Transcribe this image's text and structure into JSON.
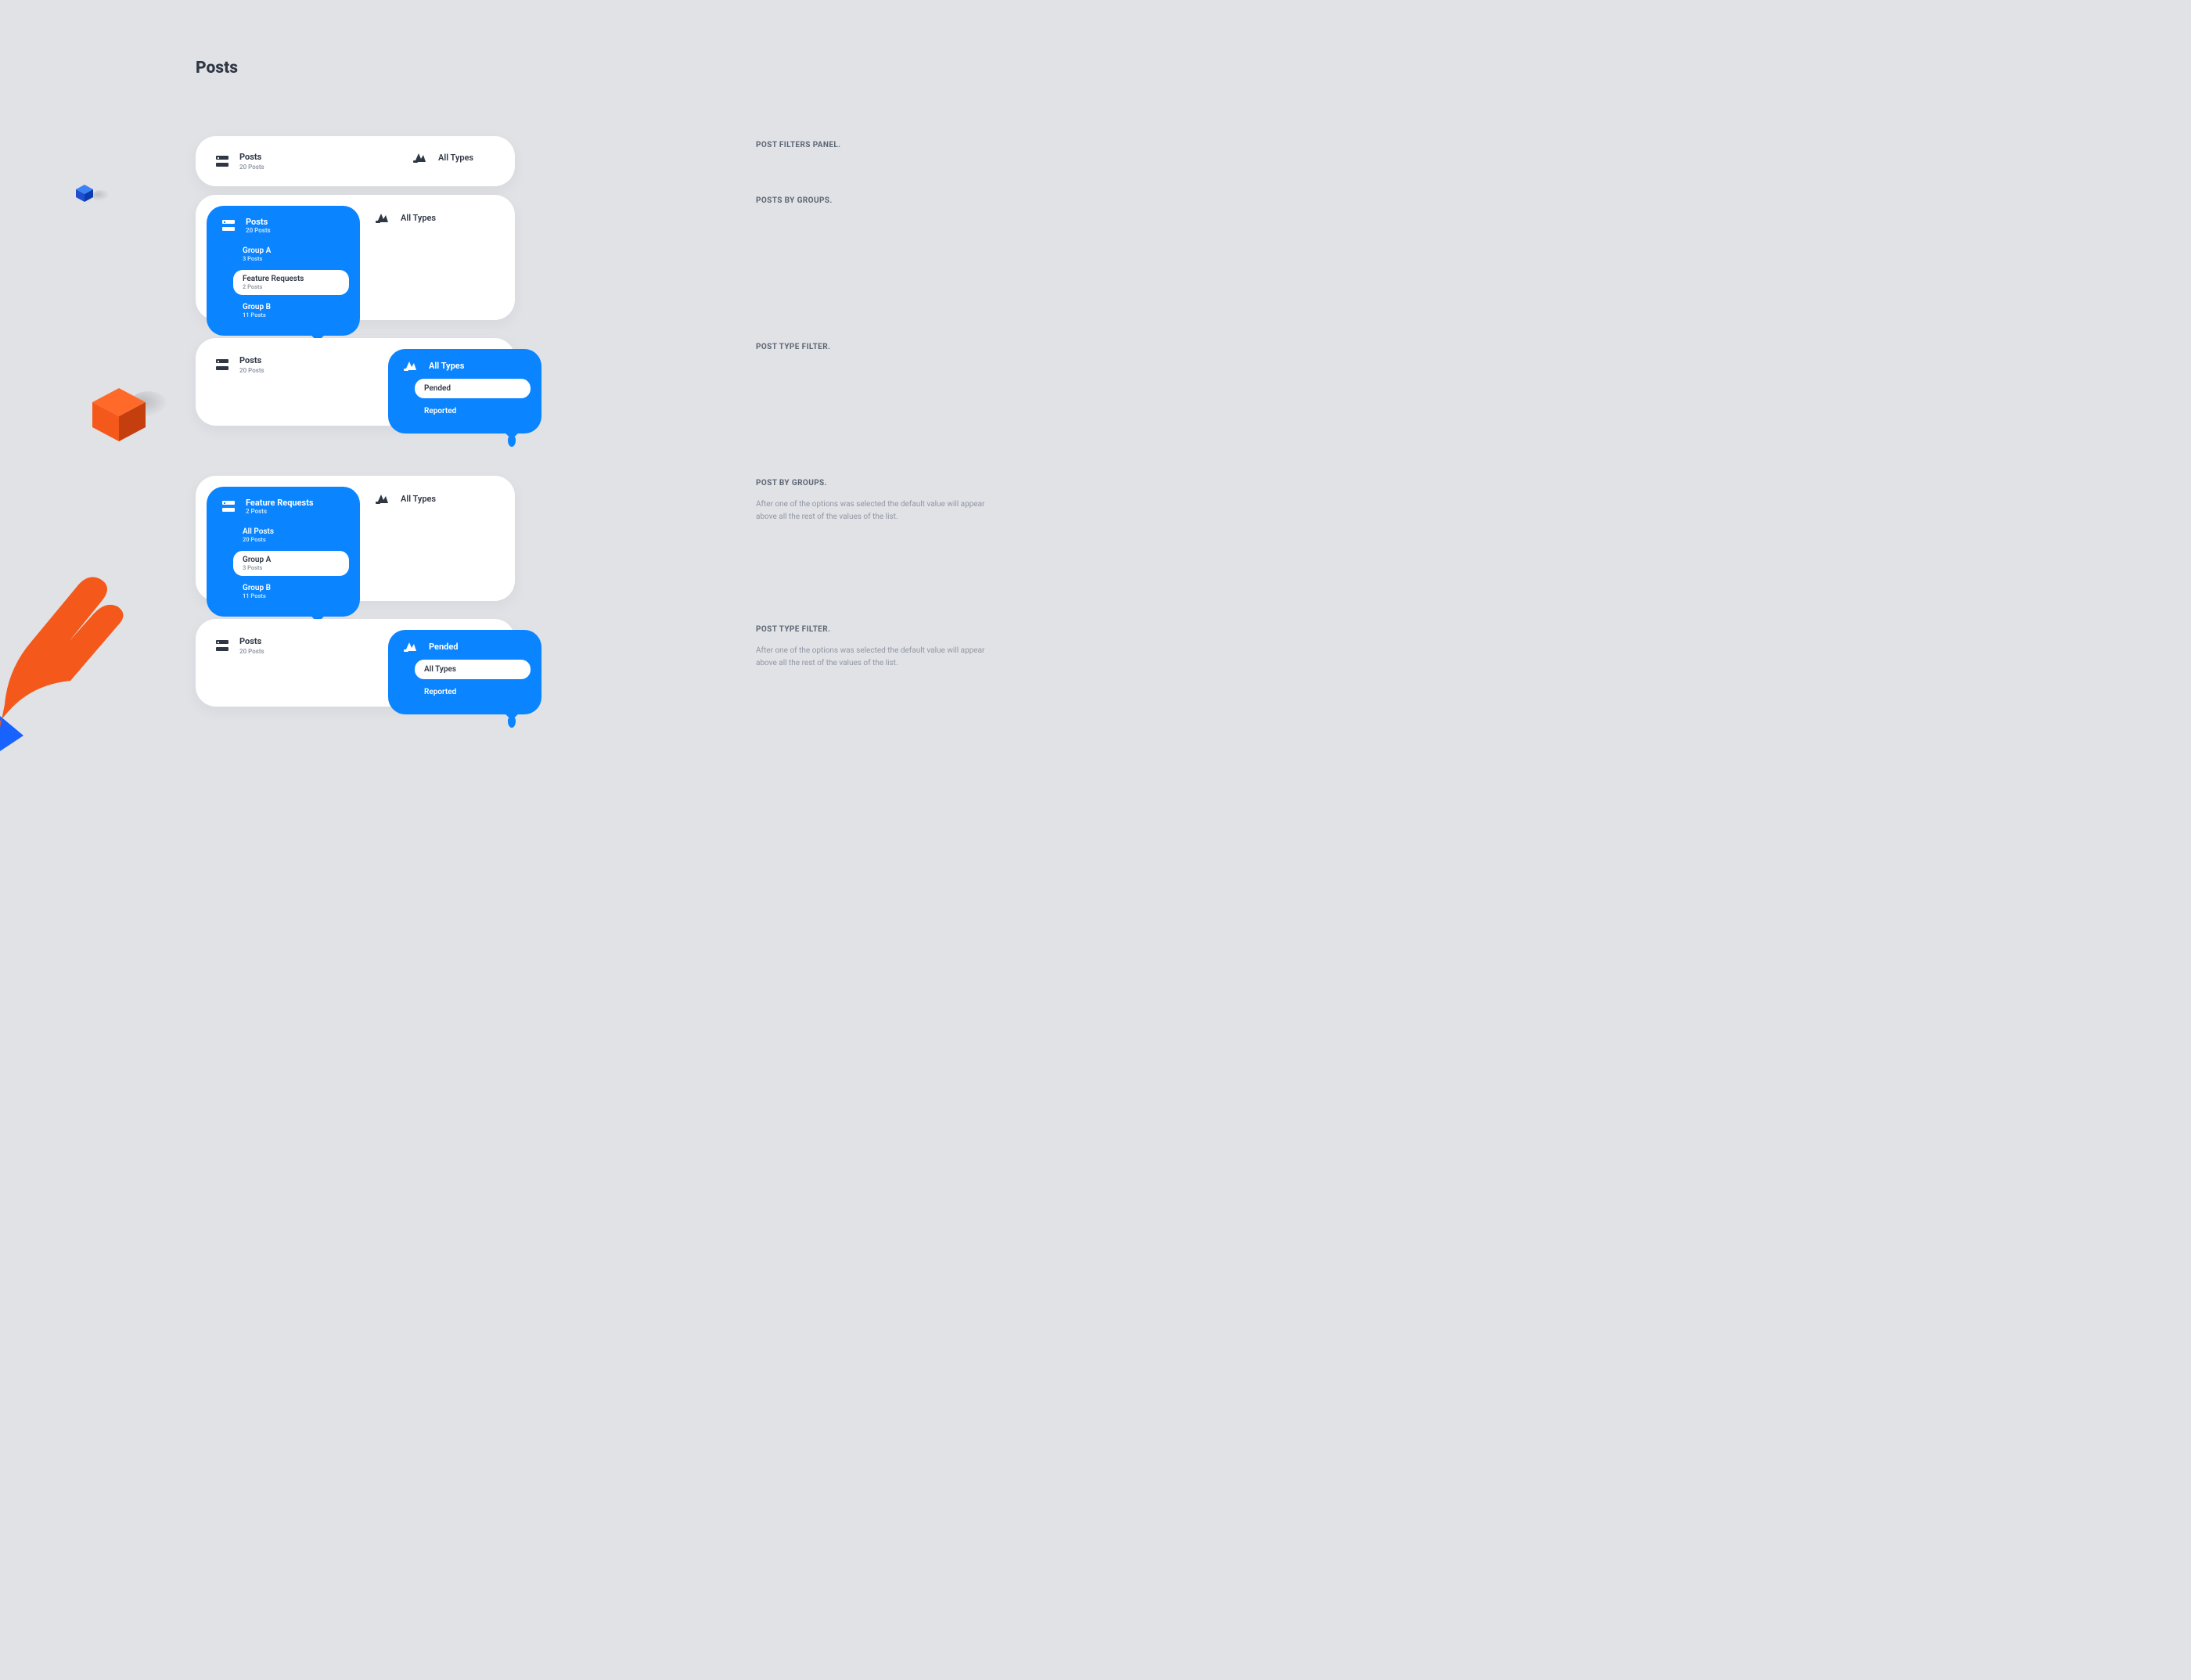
{
  "title": "Posts",
  "labels": {
    "posts": "Posts",
    "posts_count_20": "20 Posts",
    "all_types": "All Types",
    "group_a": "Group A",
    "group_a_count": "3 Posts",
    "feature_requests": "Feature Requests",
    "feature_requests_count": "2 Posts",
    "group_b": "Group B",
    "group_b_count": "11 Posts",
    "pended": "Pended",
    "reported": "Reported",
    "all_posts": "All Posts"
  },
  "descriptions": {
    "d1": "POST FILTERS PANEL.",
    "d2": "POSTS BY GROUPS.",
    "d3": "POST TYPE FILTER.",
    "d4": "POST BY GROUPS.",
    "d4_body": "After one of the options was selected the default value will appear above all the rest of the values of the list.",
    "d5": "POST TYPE FILTER.",
    "d5_body": "After one of the options was selected the default value will appear above all the rest of the values of the list."
  }
}
